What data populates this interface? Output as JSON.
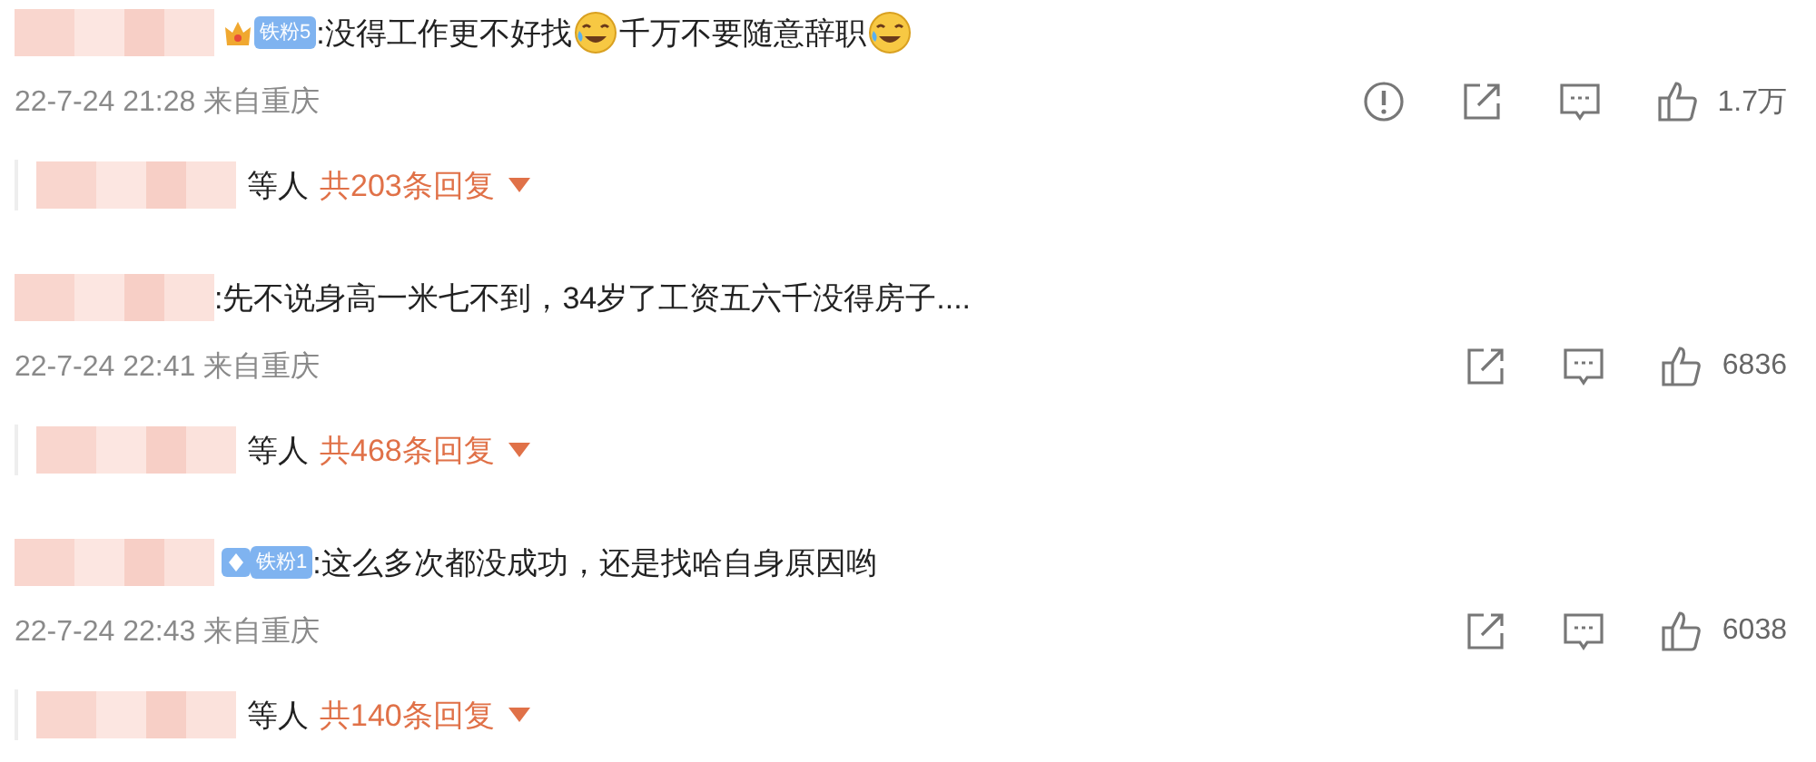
{
  "comments": [
    {
      "badge": {
        "kind": "crown",
        "label": "铁粉5"
      },
      "segments": [
        {
          "kind": "text",
          "text": ":没得工作更不好找"
        },
        {
          "kind": "emoji"
        },
        {
          "kind": "text",
          "text": "千万不要随意辞职"
        },
        {
          "kind": "emoji"
        }
      ],
      "time": "22-7-24 21:28 来自重庆",
      "report_icon": true,
      "likes": "1.7万",
      "replies": {
        "suffix": "等人",
        "count": "共203条回复"
      }
    },
    {
      "segments": [
        {
          "kind": "text",
          "text": ":先不说身高一米七不到，34岁了工资五六千没得房子...."
        }
      ],
      "time": "22-7-24 22:41 来自重庆",
      "report_icon": false,
      "likes": "6836",
      "replies": {
        "suffix": "等人",
        "count": "共468条回复"
      }
    },
    {
      "badge": {
        "kind": "diamond",
        "label": "铁粉1"
      },
      "segments": [
        {
          "kind": "text",
          "text": ":这么多次都没成功，还是找哈自身原因哟"
        }
      ],
      "time": "22-7-24 22:43 来自重庆",
      "report_icon": false,
      "likes": "6038",
      "replies": {
        "suffix": "等人",
        "count": "共140条回复"
      }
    }
  ]
}
